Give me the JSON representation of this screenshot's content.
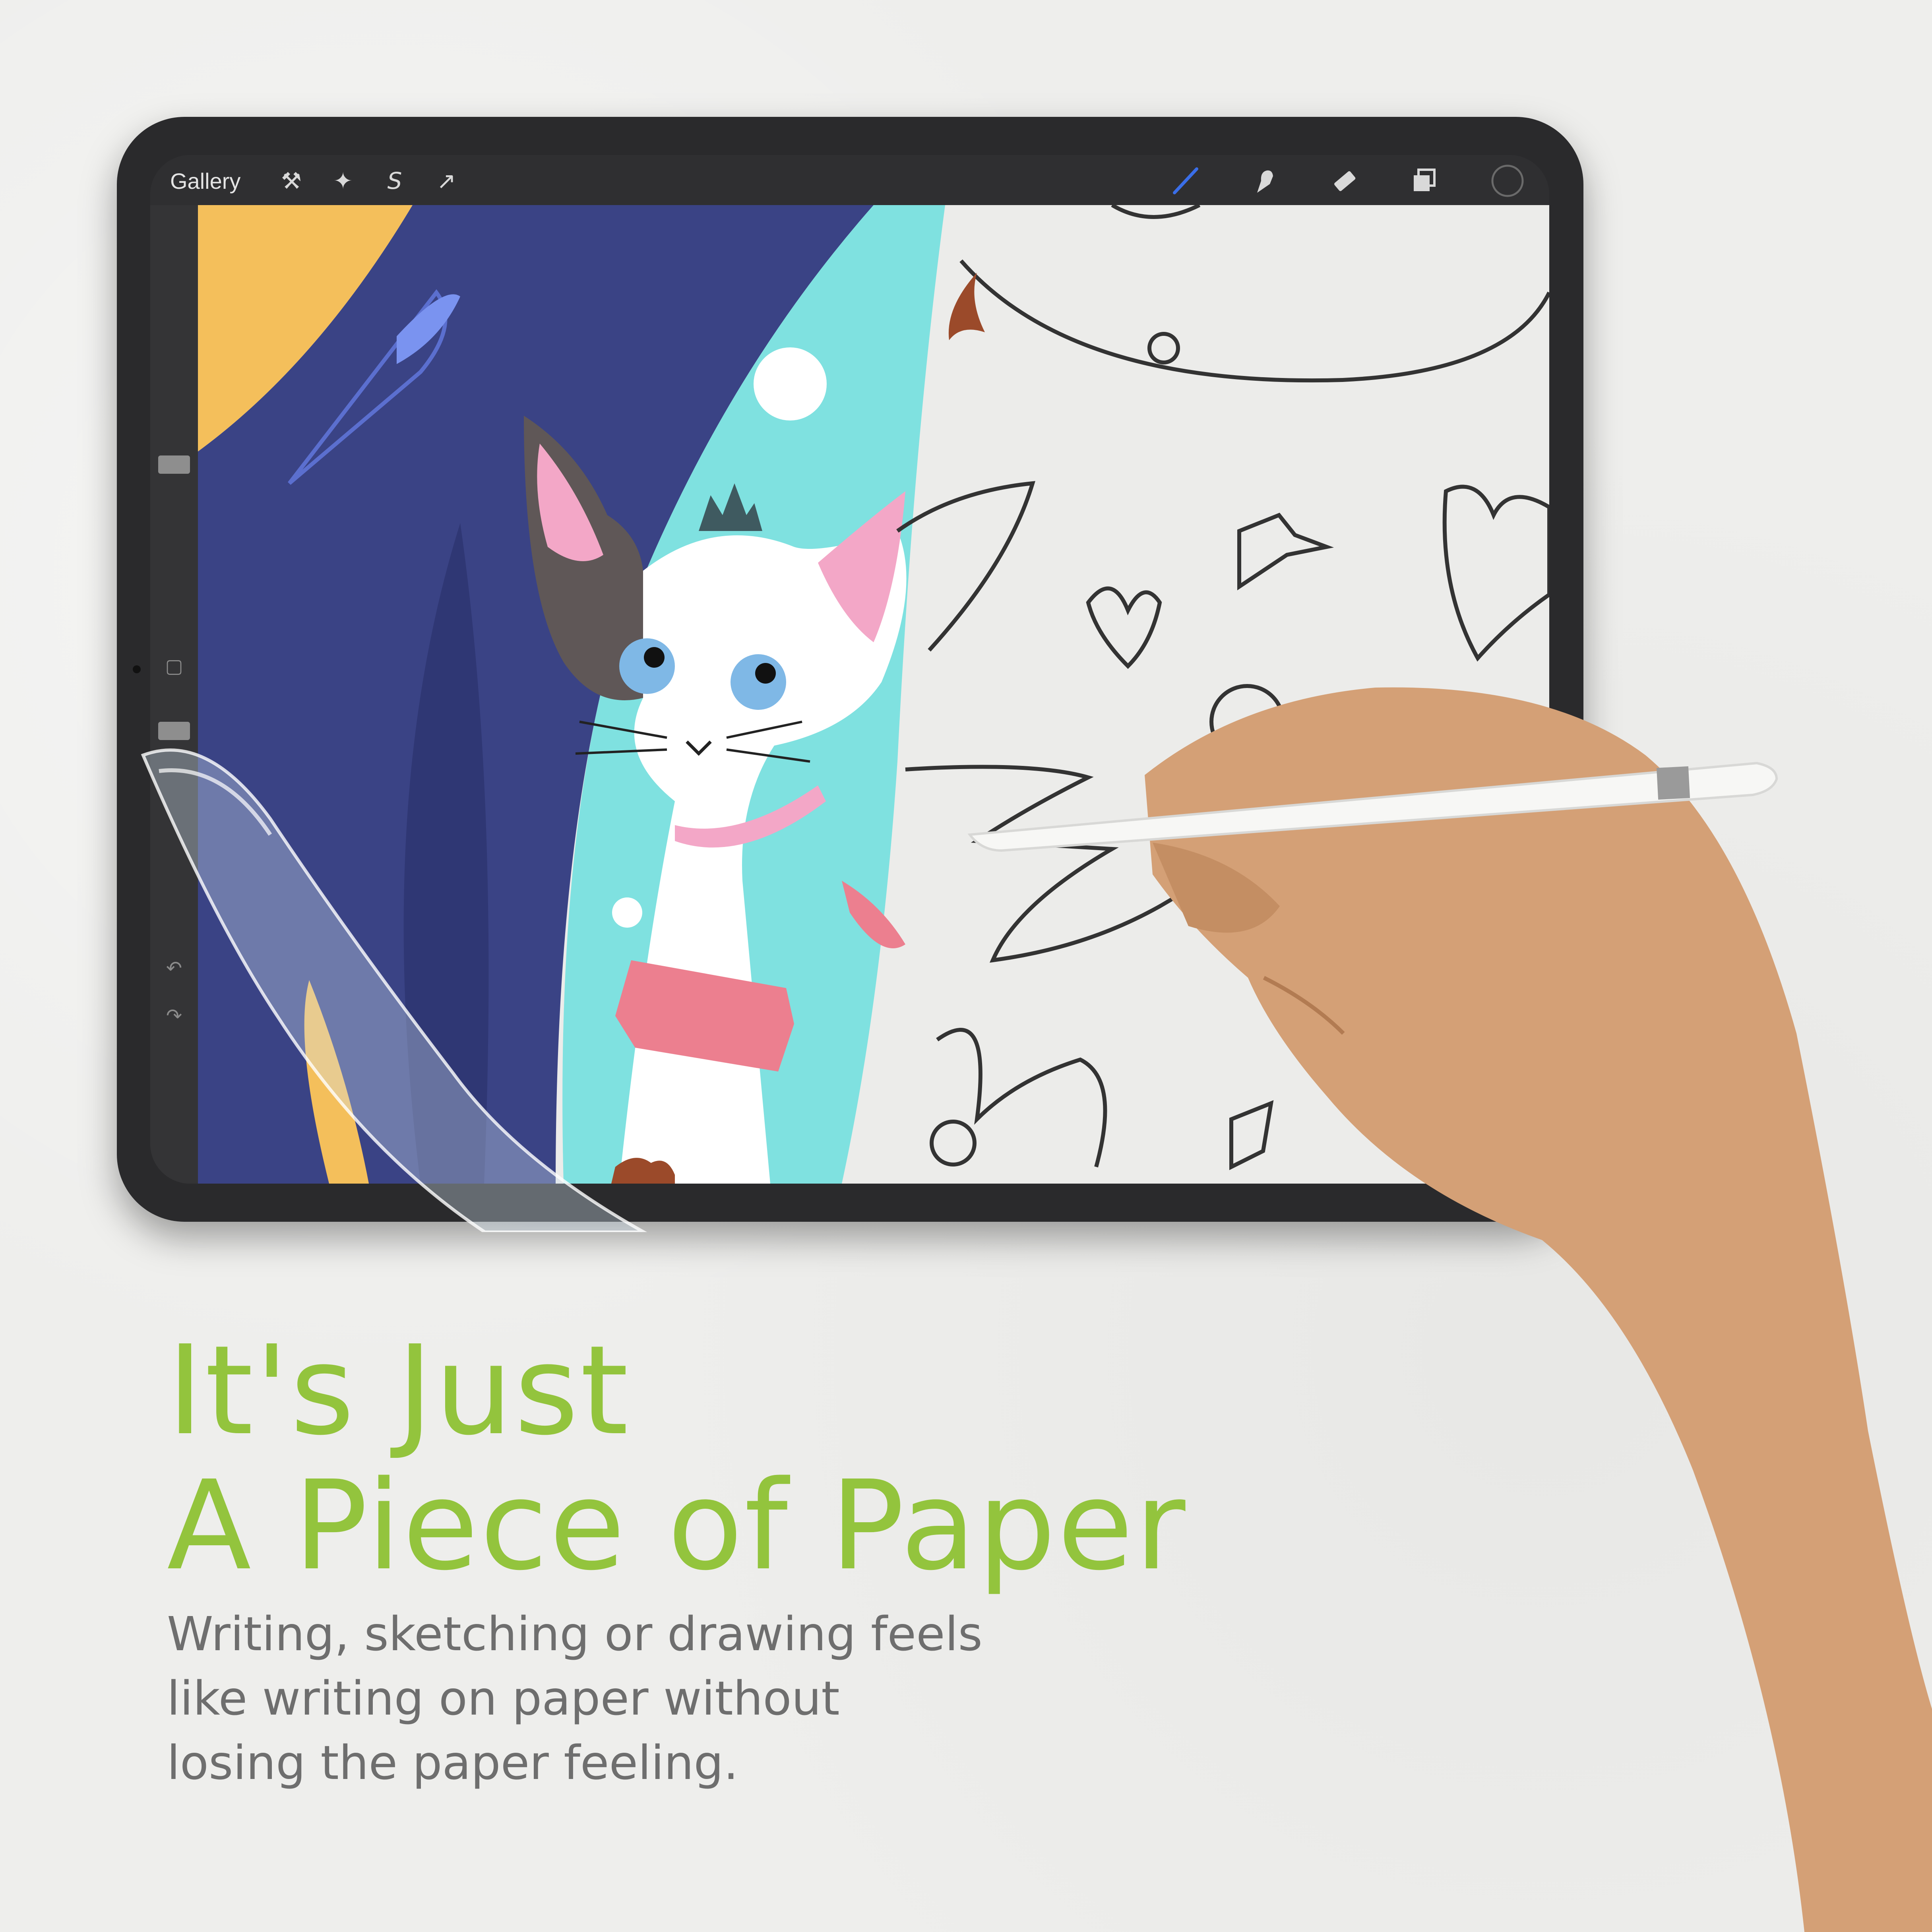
{
  "app": {
    "toolbar": {
      "gallery_label": "Gallery",
      "left_tools": [
        {
          "icon": "wrench-icon",
          "glyph": "⚒"
        },
        {
          "icon": "magic-wand-icon",
          "glyph": "✦"
        },
        {
          "icon": "selection-icon",
          "glyph": "S"
        },
        {
          "icon": "transform-arrow-icon",
          "glyph": "↗"
        }
      ],
      "right_tools": [
        {
          "icon": "brush-icon",
          "glyph": "∕"
        },
        {
          "icon": "smudge-icon",
          "glyph": "✋"
        },
        {
          "icon": "eraser-icon",
          "glyph": "▰"
        },
        {
          "icon": "layers-icon",
          "glyph": "❐"
        },
        {
          "icon": "color-picker-icon",
          "glyph": "◯"
        }
      ]
    },
    "sidebar": {
      "modify_glyph": "▢",
      "undo_glyph": "↶",
      "redo_glyph": "↷"
    }
  },
  "marketing": {
    "headline": [
      "It's Just",
      "A Piece of Paper"
    ],
    "description": [
      "Writing, sketching or drawing feels",
      "like writing on paper without",
      "losing the paper feeling."
    ]
  },
  "colors": {
    "accent_green": "#93c43d",
    "navy": "#3a4385",
    "turquoise": "#7fe1e0",
    "yellow": "#f4bf5b",
    "pink": "#f3a7c7",
    "coral": "#ec7f8f",
    "brush_blue": "#3a6ee8"
  }
}
